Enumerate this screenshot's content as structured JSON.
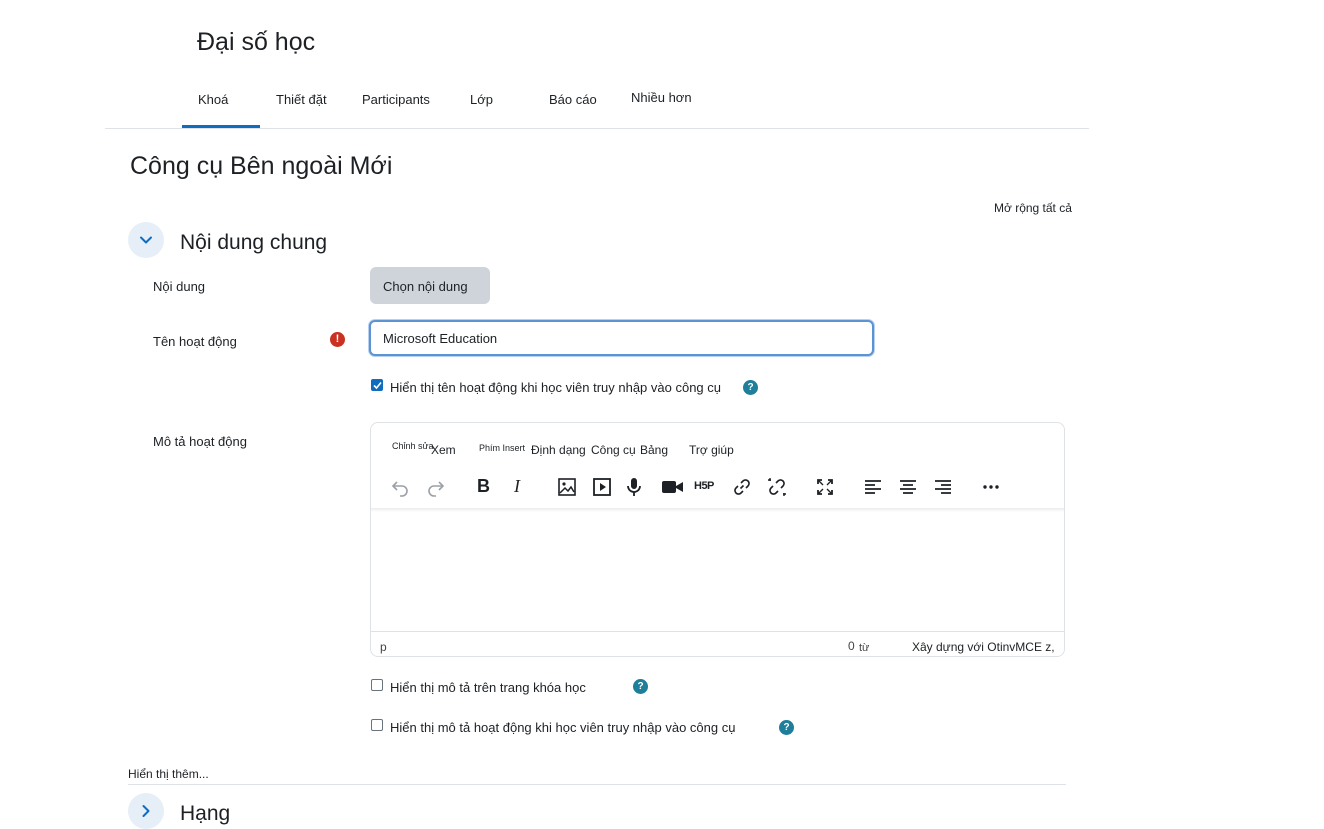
{
  "course": {
    "title": "Đại số học"
  },
  "nav": {
    "tabs": [
      "Khoá",
      "Thiết đặt",
      "Participants",
      "Lớp",
      "Báo cáo",
      "Nhiều hơn"
    ]
  },
  "page": {
    "title": "Công cụ Bên ngoài Mới",
    "expand_all": "Mở rộng tất cả"
  },
  "section_general": {
    "title": "Nội dung chung"
  },
  "form": {
    "content_label": "Nội dung",
    "choose_content_button": "Chọn nội dung",
    "activity_name_label": "Tên hoạt động",
    "activity_name_value": "Microsoft Education",
    "required_symbol": "!",
    "show_name_checkbox": {
      "label": "Hiển thị tên hoạt động khi học viên truy nhập vào công cụ",
      "checked": true
    },
    "description_label": "Mô tả hoạt động",
    "show_desc_course_checkbox": {
      "label": "Hiển thị mô tả trên trang khóa học",
      "checked": false
    },
    "show_desc_activity_checkbox": {
      "label": "Hiển thị mô tả hoạt động khi học viên truy nhập vào công cụ",
      "checked": false
    },
    "help_symbol": "?"
  },
  "editor": {
    "menu": {
      "edit": "Chỉnh sửa",
      "view": "Xem",
      "insert": "Phím Insert",
      "format": "Định dạng",
      "tools": "Công cụ",
      "table": "Bảng",
      "help": "Trợ giúp"
    },
    "toolbar_icons": [
      "undo-icon",
      "redo-icon",
      "bold-icon",
      "italic-icon",
      "image-icon",
      "media-icon",
      "microphone-icon",
      "video-camera-icon",
      "h5p-icon",
      "link-icon",
      "unlink-icon",
      "fullscreen-icon",
      "align-left-icon",
      "align-center-icon",
      "align-right-icon",
      "more-icon"
    ],
    "bold_glyph": "B",
    "italic_glyph": "I",
    "h5p_glyph": "H5P",
    "status": {
      "path": "p",
      "word_count": "0",
      "word_unit": "từ",
      "branding": "Xây dựng với OtinvMCE z,"
    }
  },
  "show_more": "Hiển thị thêm...",
  "section_grade": {
    "title": "Hạng"
  },
  "colors": {
    "accent": "#0f6cbf",
    "required": "#ca3120",
    "help": "#1f7e9a"
  }
}
